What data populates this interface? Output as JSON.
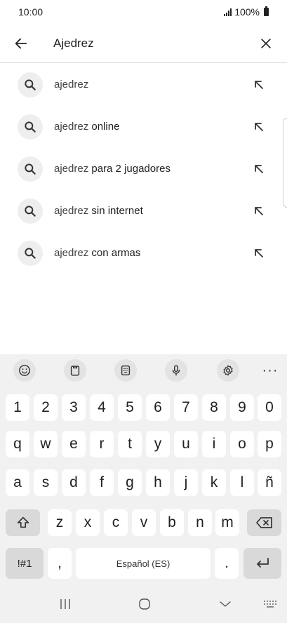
{
  "status": {
    "time": "10:00",
    "battery": "100%"
  },
  "search": {
    "value": "Ajedrez"
  },
  "suggestions": [
    {
      "query": "ajedrez",
      "completion": ""
    },
    {
      "query": "ajedrez",
      "completion": " online"
    },
    {
      "query": "ajedrez",
      "completion": " para 2 jugadores"
    },
    {
      "query": "ajedrez",
      "completion": " sin internet"
    },
    {
      "query": "ajedrez",
      "completion": " con armas"
    }
  ],
  "keyboard": {
    "toolbar": [
      "emoji-icon",
      "clipboard-icon",
      "keyboard-mode-icon",
      "microphone-icon",
      "settings-icon",
      "more-icon"
    ],
    "more_label": "···",
    "row_numbers": [
      "1",
      "2",
      "3",
      "4",
      "5",
      "6",
      "7",
      "8",
      "9",
      "0"
    ],
    "row_1": [
      "q",
      "w",
      "e",
      "r",
      "t",
      "y",
      "u",
      "i",
      "o",
      "p"
    ],
    "row_2": [
      "a",
      "s",
      "d",
      "f",
      "g",
      "h",
      "j",
      "k",
      "l",
      "ñ"
    ],
    "row_3": [
      "z",
      "x",
      "c",
      "v",
      "b",
      "n",
      "m"
    ],
    "symbols_label": "!#1",
    "comma_label": ",",
    "space_label": "Español (ES)",
    "period_label": "."
  }
}
